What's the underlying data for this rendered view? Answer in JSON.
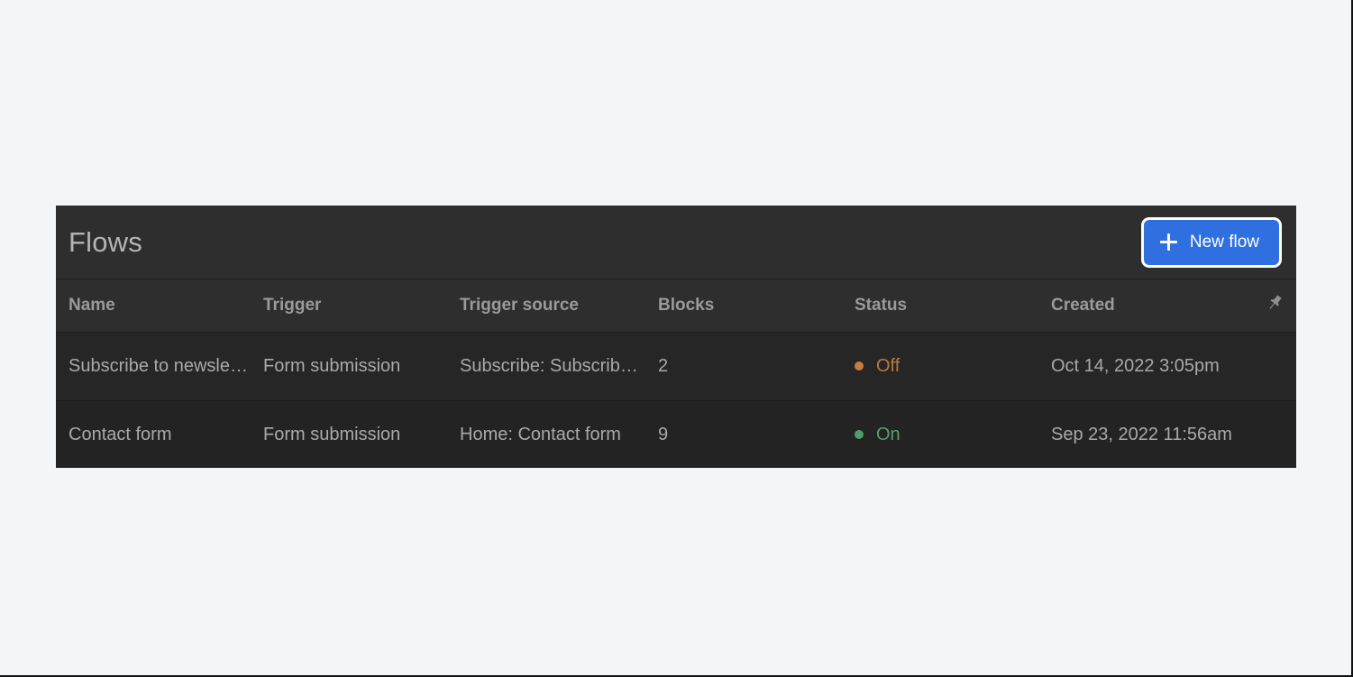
{
  "page": {
    "background_color": "#f4f5f7",
    "panel_background": "#232323"
  },
  "panel": {
    "title": "Flows",
    "title_color": "#b4b4b4",
    "header_background": "#2e2e2e",
    "new_flow_button": {
      "label": "New flow",
      "icon": "plus-icon",
      "background_color": "#2f6fe0",
      "text_color": "#ffffff",
      "focus_ring_color": "#ffffff"
    },
    "pin_icon": "pushpin-icon"
  },
  "table": {
    "columns": [
      {
        "key": "name",
        "label": "Name"
      },
      {
        "key": "trigger",
        "label": "Trigger"
      },
      {
        "key": "source",
        "label": "Trigger source"
      },
      {
        "key": "blocks",
        "label": "Blocks"
      },
      {
        "key": "status",
        "label": "Status"
      },
      {
        "key": "created",
        "label": "Created"
      }
    ],
    "header_text_color": "#9a9a9a",
    "cell_text_color": "#a9a9a9",
    "rows": [
      {
        "name": "Subscribe to newsle…",
        "trigger": "Form submission",
        "source": "Subscribe: Subscrib…",
        "blocks": "2",
        "status": "Off",
        "status_color": "#b87a42",
        "status_dot_color": "#c47d3e",
        "created": "Oct 14, 2022 3:05pm"
      },
      {
        "name": "Contact form",
        "trigger": "Form submission",
        "source": "Home: Contact form",
        "blocks": "9",
        "status": "On",
        "status_color": "#5a9e6f",
        "status_dot_color": "#4e9e6a",
        "created": "Sep 23, 2022 11:56am"
      }
    ]
  }
}
